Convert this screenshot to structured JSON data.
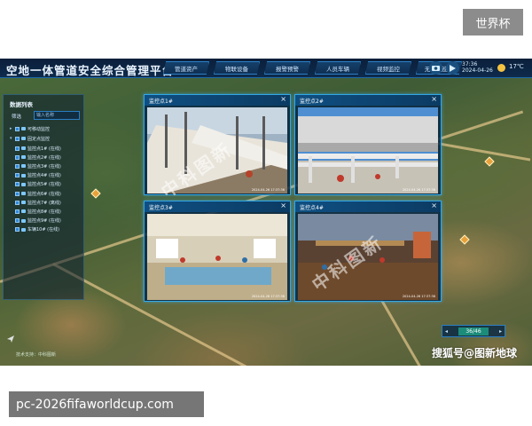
{
  "corner_tag": "世界杯",
  "header": {
    "title": "空地一体管道安全综合管理平台",
    "tabs": [
      "管道资产",
      "物联设备",
      "报警预警",
      "人员车辆",
      "视频监控",
      "无人机巡检"
    ],
    "clock_time": "37:36",
    "clock_date": "2024-04-26",
    "temperature": "17℃",
    "icons": [
      "camera-icon",
      "play-icon",
      "sun-icon"
    ]
  },
  "left_panel": {
    "title": "数据列表",
    "filter_label": "筛选",
    "search_placeholder": "输入名称",
    "tree": [
      {
        "label": "可移动监控",
        "level": 0,
        "arrow": "▸"
      },
      {
        "label": "固定点监控",
        "level": 0,
        "arrow": "▾"
      },
      {
        "label": "监控点1# (在线)",
        "level": 1
      },
      {
        "label": "监控点2# (在线)",
        "level": 1
      },
      {
        "label": "监控点3# (在线)",
        "level": 1
      },
      {
        "label": "监控点4# (在线)",
        "level": 1
      },
      {
        "label": "监控点5# (在线)",
        "level": 1
      },
      {
        "label": "监控点6# (在线)",
        "level": 1
      },
      {
        "label": "监控点7# (离线)",
        "level": 1
      },
      {
        "label": "监控点8# (在线)",
        "level": 1
      },
      {
        "label": "监控点9# (在线)",
        "level": 1
      },
      {
        "label": "车辆10# (在线)",
        "level": 1
      }
    ]
  },
  "cameras": [
    {
      "title": "监控点1#",
      "timestamp": "2024-04-26 17:37:36"
    },
    {
      "title": "监控点2#",
      "timestamp": "2024-04-26 17:37:36"
    },
    {
      "title": "监控点3#",
      "timestamp": "2024-04-26 17:37:36"
    },
    {
      "title": "监控点4#",
      "timestamp": "2024-04-26 17:37:36"
    }
  ],
  "pager": {
    "count": "36/46",
    "prev": "◂",
    "next": "▸"
  },
  "tech_support": "技术支持：中科图新",
  "brand_caption": "搜狐号@图新地球",
  "watermark_text": "中科图新",
  "url": "pc-2026fifaworldcup.com",
  "colors": {
    "accent": "#33a8e6",
    "header_bg": "#0b1f3a",
    "online": "#2f8be0"
  }
}
